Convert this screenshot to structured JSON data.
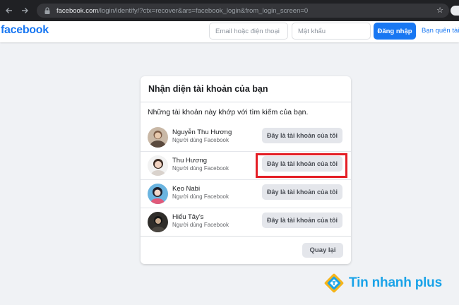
{
  "browser": {
    "url_host": "facebook.com",
    "url_path": "/login/identify/?ctx=recover&ars=facebook_login&from_login_screen=0",
    "back_icon": "back-arrow-icon",
    "forward_icon": "forward-arrow-icon",
    "reload_icon": "reload-icon"
  },
  "header": {
    "logo": "facebook",
    "email_placeholder": "Email hoặc điện thoại",
    "password_placeholder": "Mật khẩu",
    "login_label": "Đăng nhập",
    "forgot_label": "Bạn quên tài"
  },
  "card": {
    "title": "Nhận diện tài khoản của bạn",
    "description": "Những tài khoản này khớp với tìm kiếm của bạn.",
    "accounts": [
      {
        "name": "Nguyễn Thu Hương",
        "subtitle": "Người dùng Facebook",
        "button": "Đây là tài khoản của tôi"
      },
      {
        "name": "Thu Hương",
        "subtitle": "Người dùng Facebook",
        "button": "Đây là tài khoản của tôi"
      },
      {
        "name": "Kẹo Nabi",
        "subtitle": "Người dùng Facebook",
        "button": "Đây là tài khoản của tôi"
      },
      {
        "name": "Hiếu Tây's",
        "subtitle": "Người dùng Facebook",
        "button": "Đây là tài khoản của tôi"
      }
    ],
    "back_label": "Quay lại"
  },
  "watermark": {
    "text": "Tin nhanh plus"
  },
  "colors": {
    "brand": "#1877f2",
    "highlight": "#e41e26",
    "watermark": "#1aa3e8"
  }
}
